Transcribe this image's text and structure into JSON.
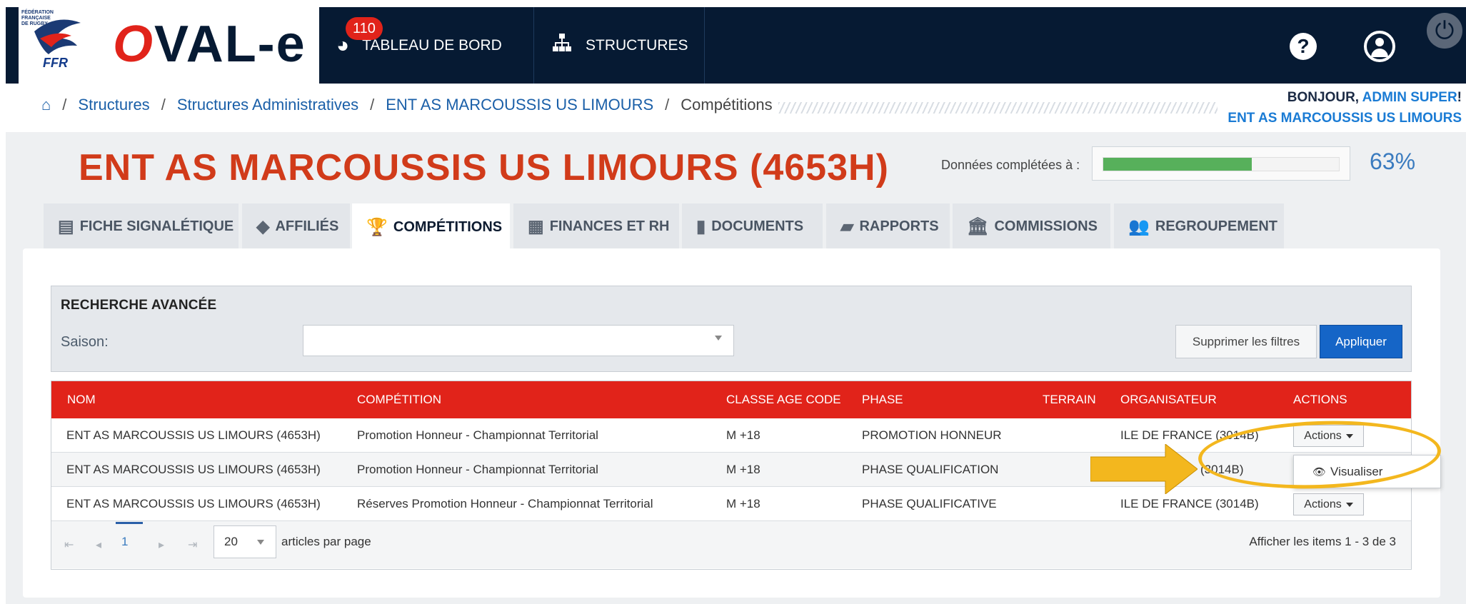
{
  "brand": {
    "federation_small": "FÉDÉRATION FRANÇAISE DE RUGBY",
    "federation": "FFR",
    "app_name": "OVAL-e",
    "colors": {
      "navy": "#061a33",
      "red": "#e1231a",
      "blue": "#1565c7",
      "green": "#57b05b"
    }
  },
  "nav": {
    "badge": "110",
    "dashboard": "TABLEAU DE BORD",
    "structures": "STRUCTURES",
    "icons": [
      "dashboard-gauge-icon",
      "sitemap-icon",
      "help-icon",
      "user-icon",
      "power-icon"
    ]
  },
  "breadcrumb": {
    "items": [
      "Structures",
      "Structures Administratives",
      "ENT AS MARCOUSSIS US LIMOURS"
    ],
    "current": "Compétitions",
    "separator": "/"
  },
  "greeting": {
    "hello": "BONJOUR,",
    "user": "ADMIN SUPER",
    "exclaim": "!",
    "structure": "ENT AS MARCOUSSIS US LIMOURS"
  },
  "page": {
    "title": "ENT AS MARCOUSSIS US LIMOURS (4653H)",
    "completed_label": "Données complétées à :",
    "completed_percent": "63%",
    "completed_fraction": 0.63
  },
  "tabs": [
    {
      "label": "FICHE SIGNALÉTIQUE",
      "icon": "file-icon"
    },
    {
      "label": "AFFILIÉS",
      "icon": "tag-icon"
    },
    {
      "label": "COMPÉTITIONS",
      "icon": "trophy-icon",
      "active": true
    },
    {
      "label": "FINANCES ET RH",
      "icon": "calculator-icon"
    },
    {
      "label": "DOCUMENTS",
      "icon": "document-icon"
    },
    {
      "label": "RAPPORTS",
      "icon": "book-icon"
    },
    {
      "label": "COMMISSIONS",
      "icon": "institution-icon"
    },
    {
      "label": "REGROUPEMENT",
      "icon": "users-icon"
    }
  ],
  "search": {
    "title": "RECHERCHE AVANCÉE",
    "saison_label": "Saison:",
    "saison_value": "",
    "clear_label": "Supprimer les filtres",
    "apply_label": "Appliquer"
  },
  "table": {
    "columns": [
      "NOM",
      "COMPÉTITION",
      "CLASSE AGE CODE",
      "PHASE",
      "TERRAIN",
      "ORGANISATEUR",
      "ACTIONS"
    ],
    "rows": [
      {
        "nom": "ENT AS MARCOUSSIS US LIMOURS (4653H)",
        "competition": "Promotion Honneur - Championnat Territorial",
        "classe": "M +18",
        "phase": "PROMOTION HONNEUR",
        "terrain": "",
        "organisateur": "ILE DE FRANCE (3014B)",
        "action": "Actions"
      },
      {
        "nom": "ENT AS MARCOUSSIS US LIMOURS (4653H)",
        "competition": "Promotion Honneur - Championnat Territorial",
        "classe": "M +18",
        "phase": "PHASE QUALIFICATION",
        "terrain": "",
        "organisateur": "(3014B)",
        "action": ""
      },
      {
        "nom": "ENT AS MARCOUSSIS US LIMOURS (4653H)",
        "competition": "Réserves Promotion Honneur - Championnat Territorial",
        "classe": "M +18",
        "phase": "PHASE QUALIFICATIVE",
        "terrain": "",
        "organisateur": "ILE DE FRANCE (3014B)",
        "action": "Actions"
      }
    ],
    "dropdown_item": "Visualiser"
  },
  "pager": {
    "current_page": "1",
    "per_page": "20",
    "per_page_label": "articles par page",
    "items_info": "Afficher les items 1 - 3 de 3"
  }
}
